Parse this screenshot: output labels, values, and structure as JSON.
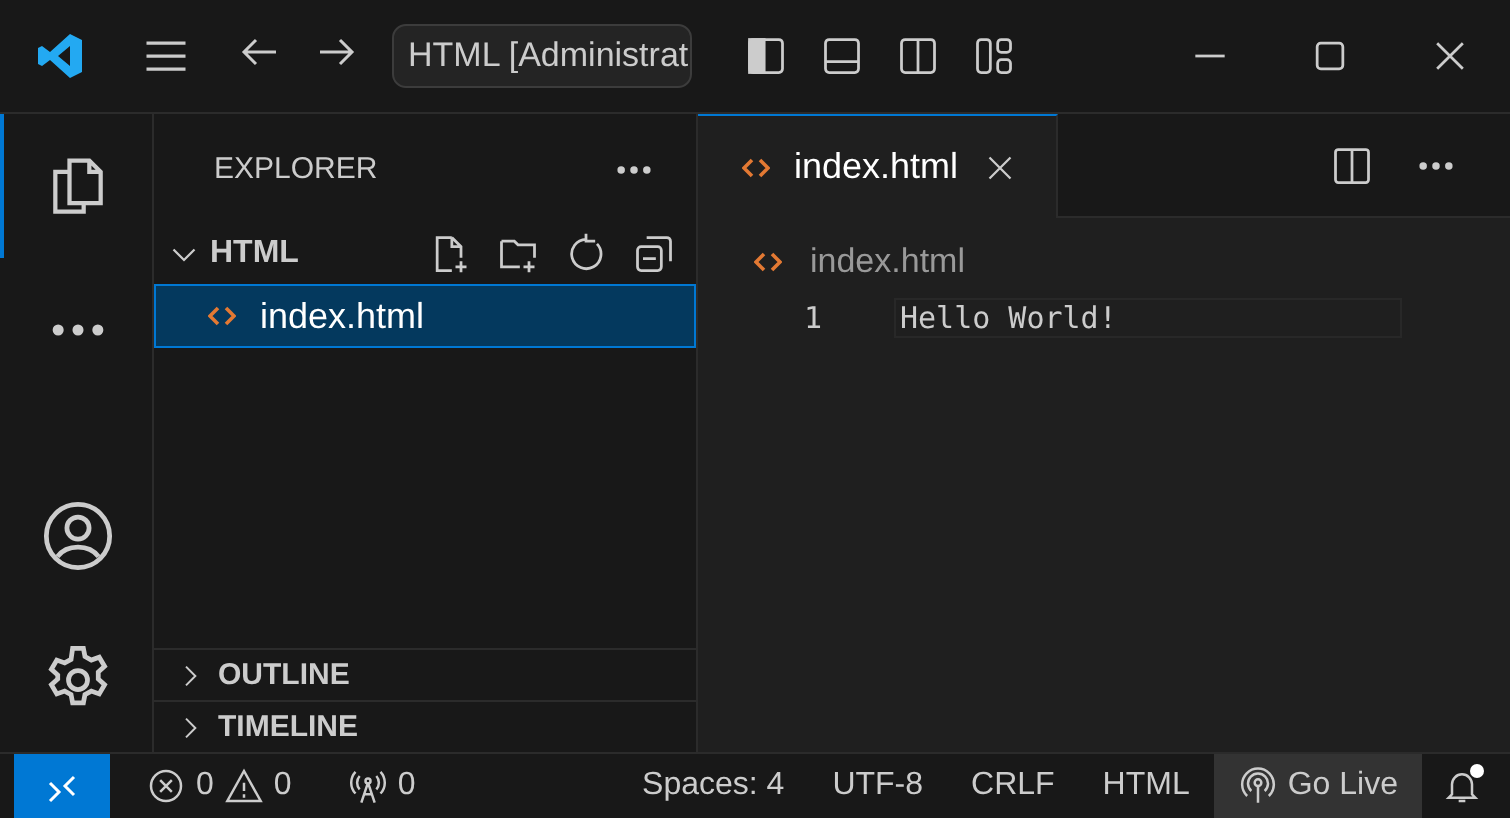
{
  "title_bar": {
    "command_center": "HTML [Administrat"
  },
  "activity_bar": {
    "items": [
      {
        "kind": "explorer",
        "selected": true
      },
      {
        "kind": "more",
        "selected": false
      }
    ],
    "bottom": [
      {
        "kind": "account"
      },
      {
        "kind": "settings"
      }
    ]
  },
  "sidebar": {
    "title": "EXPLORER",
    "folder": {
      "name": "HTML",
      "expanded": true,
      "files": [
        {
          "name": "index.html",
          "selected": true
        }
      ]
    },
    "sections": [
      {
        "name": "OUTLINE",
        "expanded": false
      },
      {
        "name": "TIMELINE",
        "expanded": false
      }
    ]
  },
  "editor": {
    "tabs": [
      {
        "label": "index.html",
        "selected": true
      }
    ],
    "breadcrumb": "index.html",
    "lines": [
      {
        "number": "1",
        "text": "Hello World!"
      }
    ]
  },
  "status_bar": {
    "errors": "0",
    "warnings": "0",
    "ports": "0",
    "items": [
      "Spaces: 4",
      "UTF-8",
      "CRLF",
      "HTML"
    ],
    "go_live": "Go Live",
    "new_notifications": true
  }
}
